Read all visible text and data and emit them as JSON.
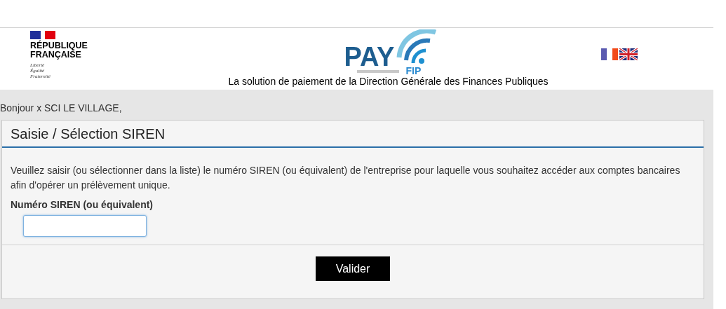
{
  "header": {
    "republic": {
      "name": "RÉPUBLIQUE FRANÇAISE",
      "motto": [
        "Liberté",
        "Égalité",
        "Fraternité"
      ]
    },
    "logo": {
      "main": "PAY",
      "sub": "FIP"
    },
    "tagline": "La solution de paiement de la Direction Générale des Finances Publiques",
    "languages": [
      {
        "kind": "fr"
      },
      {
        "kind": "en"
      }
    ]
  },
  "greeting": "Bonjour x SCI LE VILLAGE,",
  "panel": {
    "title": "Saisie / Sélection SIREN",
    "instructions": "Veuillez saisir (ou sélectionner dans la liste) le numéro SIREN (ou équivalent) de l'entreprise pour laquelle vous souhaitez accéder aux comptes bancaires afin d'opérer un prélèvement unique.",
    "field_label": "Numéro SIREN (ou équivalent)",
    "submit": "Valider"
  }
}
